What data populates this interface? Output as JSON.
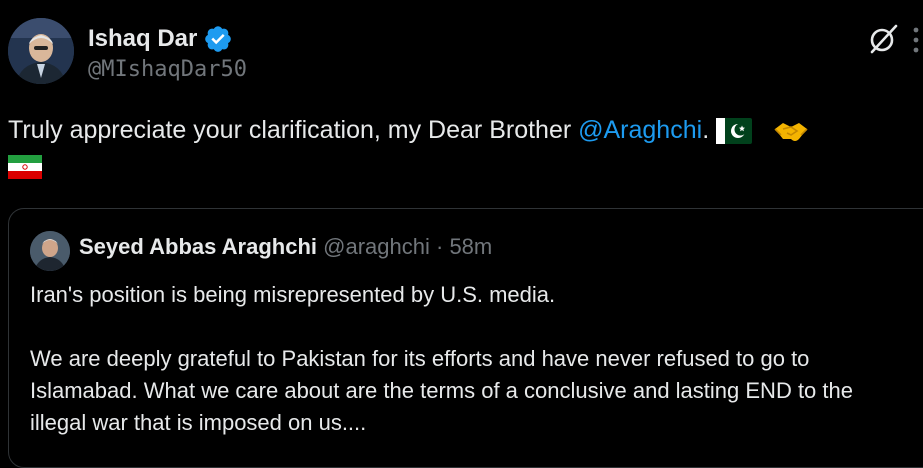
{
  "author": {
    "name": "Ishaq Dar",
    "handle": "@MIshaqDar50",
    "verified": true
  },
  "tweet": {
    "text_before": "Truly appreciate your clarification, my Dear Brother ",
    "mention": "@Araghchi",
    "text_after": ". ",
    "emojis": [
      "pakistan-flag",
      "handshake",
      "iran-flag"
    ]
  },
  "quoted": {
    "name": "Seyed Abbas Araghchi",
    "handle": "@araghchi",
    "separator": "·",
    "time": "58m",
    "paragraph1": "Iran's position is being misrepresented by U.S. media.",
    "paragraph2": "We are deeply grateful to Pakistan for its efforts and have never refused to go to Islamabad. What we care about are the terms of a conclusive and lasting END to the illegal war that is imposed on us...."
  },
  "colors": {
    "background": "#000000",
    "text": "#e7e9ea",
    "muted": "#71767b",
    "link": "#1d9bf0",
    "border": "#2f3336"
  }
}
